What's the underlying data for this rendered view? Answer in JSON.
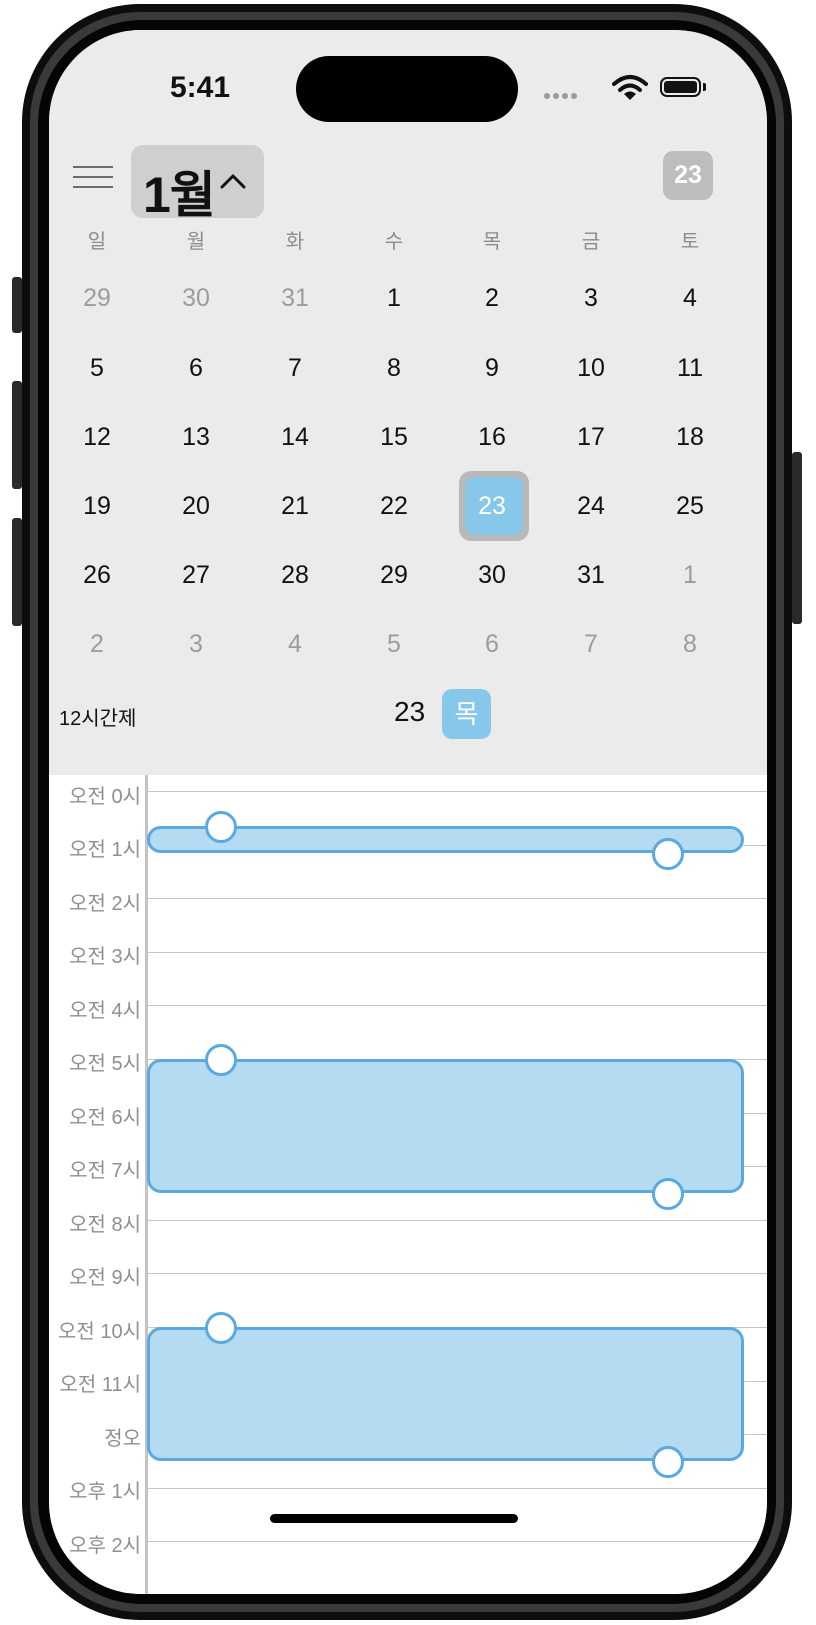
{
  "status_bar": {
    "time": "5:41"
  },
  "header": {
    "month_label": "1월",
    "today_label": "23"
  },
  "weekdays": [
    "일",
    "월",
    "화",
    "수",
    "목",
    "금",
    "토"
  ],
  "calendar": {
    "weeks": [
      [
        {
          "d": "29",
          "muted": true
        },
        {
          "d": "30",
          "muted": true
        },
        {
          "d": "31",
          "muted": true
        },
        {
          "d": "1"
        },
        {
          "d": "2"
        },
        {
          "d": "3"
        },
        {
          "d": "4"
        }
      ],
      [
        {
          "d": "5"
        },
        {
          "d": "6"
        },
        {
          "d": "7"
        },
        {
          "d": "8"
        },
        {
          "d": "9"
        },
        {
          "d": "10"
        },
        {
          "d": "11"
        }
      ],
      [
        {
          "d": "12"
        },
        {
          "d": "13"
        },
        {
          "d": "14"
        },
        {
          "d": "15"
        },
        {
          "d": "16"
        },
        {
          "d": "17"
        },
        {
          "d": "18"
        }
      ],
      [
        {
          "d": "19"
        },
        {
          "d": "20"
        },
        {
          "d": "21"
        },
        {
          "d": "22"
        },
        {
          "d": "23",
          "selected": true
        },
        {
          "d": "24"
        },
        {
          "d": "25"
        }
      ],
      [
        {
          "d": "26"
        },
        {
          "d": "27"
        },
        {
          "d": "28"
        },
        {
          "d": "29"
        },
        {
          "d": "30"
        },
        {
          "d": "31"
        },
        {
          "d": "1",
          "muted": true
        }
      ],
      [
        {
          "d": "2",
          "muted": true
        },
        {
          "d": "3",
          "muted": true
        },
        {
          "d": "4",
          "muted": true
        },
        {
          "d": "5",
          "muted": true
        },
        {
          "d": "6",
          "muted": true
        },
        {
          "d": "7",
          "muted": true
        },
        {
          "d": "8",
          "muted": true
        }
      ]
    ]
  },
  "day_header": {
    "mode_label": "12시간제",
    "date_number": "23",
    "weekday_badge": "목"
  },
  "timeline": {
    "hour_labels": [
      "오전 0시",
      "오전 1시",
      "오전 2시",
      "오전 3시",
      "오전 4시",
      "오전 5시",
      "오전 6시",
      "오전 7시",
      "오전 8시",
      "오전 9시",
      "오전 10시",
      "오전 11시",
      "정오",
      "오후 1시",
      "오후 2시"
    ],
    "events": [
      {
        "start_hour": 0.65,
        "end_hour": 1.15
      },
      {
        "start_hour": 5.0,
        "end_hour": 7.5
      },
      {
        "start_hour": 10.0,
        "end_hour": 12.5
      }
    ]
  },
  "colors": {
    "accent": "#87c8ea",
    "event_fill": "#b5dbf2",
    "event_border": "#5aa9e0",
    "panel_bg": "#ebebeb"
  }
}
